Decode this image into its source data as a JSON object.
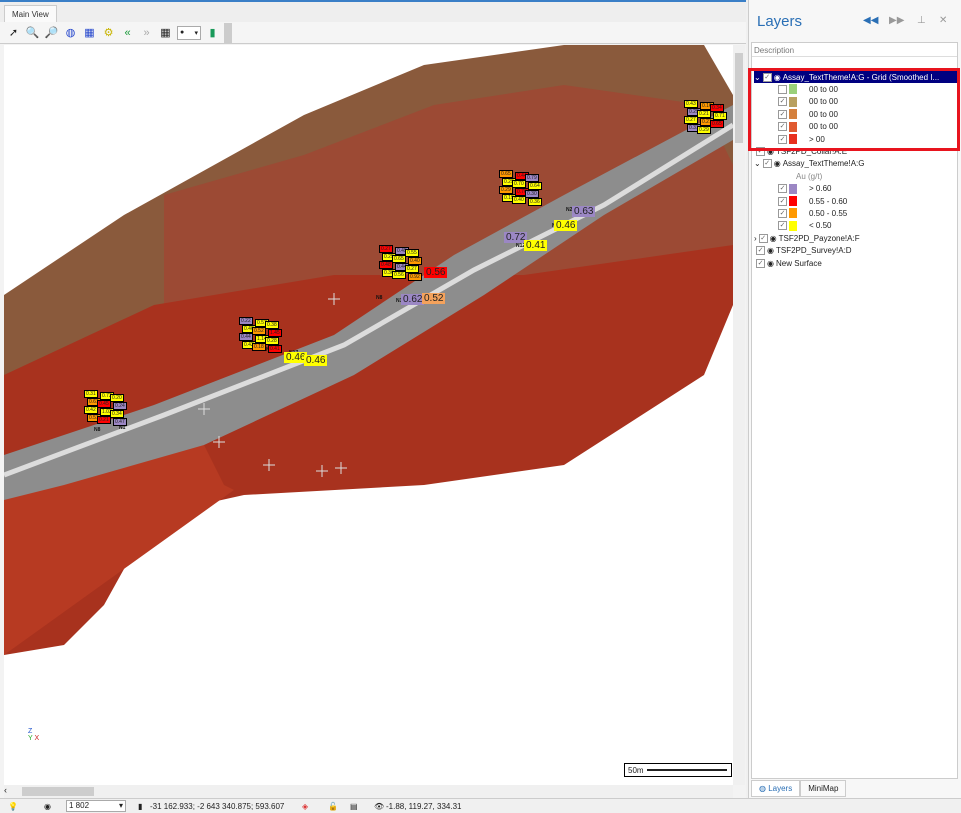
{
  "tabs": {
    "main_view": "Main View"
  },
  "toolbar": {
    "icons": [
      "pointer-icon",
      "zoom-in-icon",
      "zoom-out-icon",
      "globe-icon",
      "globe-grid-icon",
      "gear-icon",
      "rewind-icon",
      "forward-icon",
      "grid-icon",
      "color-palette-icon",
      "marker-icon"
    ]
  },
  "viewport": {
    "hole_names": [
      {
        "t": "N1",
        "c": "nh1"
      },
      {
        "t": "N8",
        "c": "nh2"
      },
      {
        "t": "N4",
        "c": "nh3"
      },
      {
        "t": "N17",
        "c": "nh4"
      },
      {
        "t": "N3",
        "c": "nh5"
      },
      {
        "t": "N8",
        "c": "nh6"
      },
      {
        "t": "N16",
        "c": "nh7"
      },
      {
        "t": "N12",
        "c": "nh8"
      },
      {
        "t": "N7",
        "c": "nh9"
      },
      {
        "t": "N2",
        "c": "nh10"
      }
    ],
    "big_labels": [
      {
        "t": "0.46",
        "color": "#ffff00"
      },
      {
        "t": "0.46",
        "color": "#ffff00"
      },
      {
        "t": "0.62",
        "color": "#9b87c4"
      },
      {
        "t": "0.52",
        "color": "#f4a25c"
      },
      {
        "t": "0.72",
        "color": "#9b87c4"
      },
      {
        "t": "0.41",
        "color": "#ffff00"
      },
      {
        "t": "0.46",
        "color": "#ffff00"
      },
      {
        "t": "0.63",
        "color": "#9b87c4"
      },
      {
        "t": "0.56",
        "color": "#ff0000"
      }
    ],
    "small_labels": [
      "0.31",
      "0.22",
      "0.27",
      "0.65",
      "0.43",
      "0.72",
      "0.57",
      "0.45",
      "0.44",
      "0.16",
      "0.20",
      "0.38",
      "0.55",
      "0.79",
      "0.34",
      "0.61",
      "0.46",
      "0.25",
      "0.29",
      "0.29",
      "0.45",
      "0.52",
      "0.65",
      "0.70",
      "0.21",
      "0.24",
      "1.45",
      "0.40",
      "0.64",
      "0.71",
      "0.42",
      "0.44",
      "0.48",
      "0.29",
      "0.27",
      "1.03",
      "1.14",
      "0.44",
      "0.76",
      "0.21",
      "0.34",
      "0.28",
      "0.27",
      "0.30",
      "0.65",
      "0.51",
      "0.42",
      "0.36",
      "0.19",
      "0.31",
      "0.21",
      "0.18",
      "0.56",
      "0.40",
      "0.29",
      "0.47",
      "0.41",
      "0.92",
      "0.36"
    ],
    "scale_label": "50m",
    "axis": {
      "z": "Z",
      "y": "Y",
      "x": "X"
    }
  },
  "layers_panel": {
    "title": "Layers",
    "column_header": "Description",
    "items": [
      {
        "name": "Assay_TextTheme!A:G - Grid (Smoothed I...",
        "selected": true,
        "legend": [
          {
            "label": "00 to 00",
            "color": "#9ad07a",
            "checked": false
          },
          {
            "label": "00 to 00",
            "color": "#b8a060",
            "checked": true
          },
          {
            "label": "00 to 00",
            "color": "#d4803e",
            "checked": true
          },
          {
            "label": "00 to 00",
            "color": "#e05a30",
            "checked": true
          },
          {
            "label": "> 00",
            "color": "#e8301e",
            "checked": true
          }
        ]
      },
      {
        "name": "TSF2PD_Collar!A:E"
      },
      {
        "name": "Assay_TextTheme!A:G",
        "sub": "Au (g/t)",
        "legend": [
          {
            "label": "> 0.60",
            "color": "#9b87c4",
            "checked": true
          },
          {
            "label": "0.55 - 0.60",
            "color": "#ff0000",
            "checked": true
          },
          {
            "label": "0.50 - 0.55",
            "color": "#ff9900",
            "checked": true
          },
          {
            "label": "< 0.50",
            "color": "#ffff00",
            "checked": true
          }
        ]
      },
      {
        "name": "TSF2PD_Payzone!A:F"
      },
      {
        "name": "TSF2PD_Survey!A:D"
      },
      {
        "name": "New Surface"
      }
    ],
    "bottom_tabs": [
      "Layers",
      "MiniMap"
    ]
  },
  "status": {
    "scale": "1 802",
    "mouse_coords": "-31 162.933; -2 643 340.875; 593.607",
    "camera": "-1.88, 119.27, 334.31"
  },
  "colors": {
    "accent": "#2a6fb5",
    "selection": "#000080",
    "highlight_box": "#e8141e"
  }
}
